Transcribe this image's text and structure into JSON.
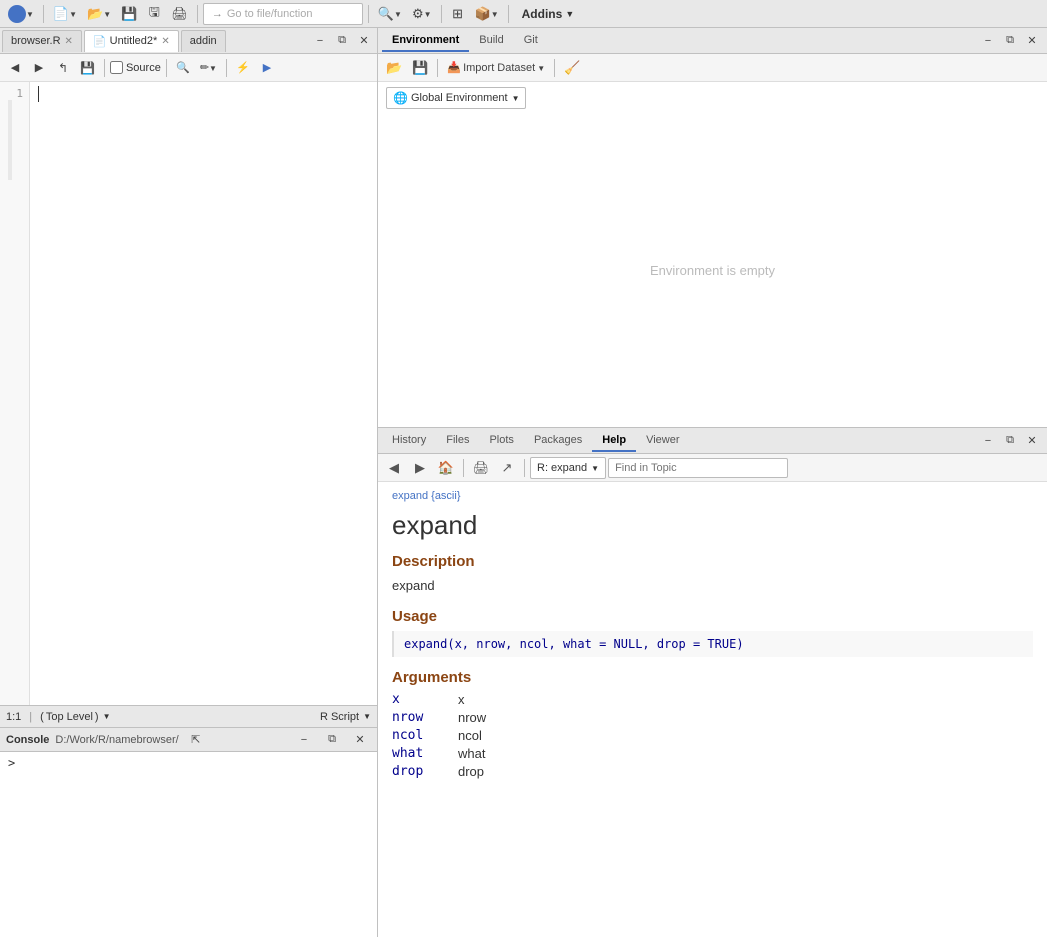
{
  "topToolbar": {
    "gotoPlaceholder": "Go to file/function",
    "addinsLabel": "Addins",
    "addinsChevron": "▼"
  },
  "editorTabs": [
    {
      "label": "browser.R",
      "active": false,
      "closable": true
    },
    {
      "label": "Untitled2*",
      "active": true,
      "closable": true
    },
    {
      "label": "addin",
      "active": false,
      "closable": false
    }
  ],
  "editorToolbar": {
    "sourceLabel": "Source",
    "findLabel": "🔍",
    "pencilLabel": "✏"
  },
  "statusBar": {
    "position": "1:1",
    "level": "Top Level",
    "scriptType": "R Script"
  },
  "consolePanel": {
    "title": "Console",
    "path": "D:/Work/R/namebrowser/",
    "prompt": ">"
  },
  "envPanel": {
    "tabs": [
      "Environment",
      "Build",
      "Git"
    ],
    "activeTab": "Environment",
    "emptyMessage": "Environment is empty",
    "globalEnvLabel": "Global Environment",
    "importDatasetLabel": "Import Dataset"
  },
  "helpPanel": {
    "tabs": [
      "History",
      "Files",
      "Plots",
      "Packages",
      "Help",
      "Viewer"
    ],
    "activeTab": "Help",
    "searchPlaceholder": "Find in Topic",
    "rExpandLabel": "R: expand",
    "breadcrumb": "expand {ascii}",
    "title": "expand",
    "sections": [
      {
        "name": "Description",
        "content": "expand",
        "type": "text"
      },
      {
        "name": "Usage",
        "content": "expand(x, nrow, ncol, what = NULL, drop = TRUE)",
        "type": "code"
      },
      {
        "name": "Arguments",
        "type": "args",
        "args": [
          {
            "name": "x",
            "desc": "x"
          },
          {
            "name": "nrow",
            "desc": "nrow"
          },
          {
            "name": "ncol",
            "desc": "ncol"
          },
          {
            "name": "what",
            "desc": "what"
          },
          {
            "name": "drop",
            "desc": "drop"
          }
        ]
      }
    ]
  }
}
